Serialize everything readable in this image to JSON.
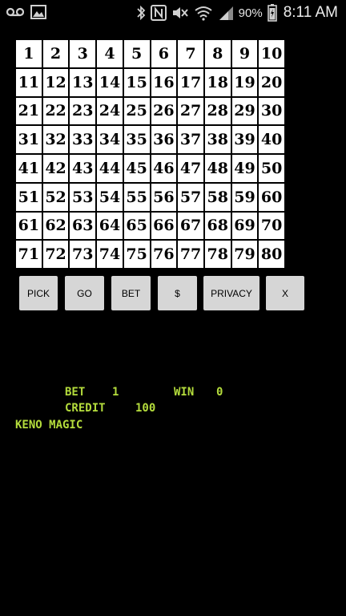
{
  "status_bar": {
    "left_icons": [
      "voicemail-icon",
      "image-icon"
    ],
    "right_icons": [
      "bluetooth-icon",
      "nfc-icon",
      "mute-icon",
      "wifi-icon",
      "signal-icon",
      "battery-icon"
    ],
    "battery_percent": "90%",
    "time": "8:11 AM"
  },
  "board": {
    "numbers": [
      "1",
      "2",
      "3",
      "4",
      "5",
      "6",
      "7",
      "8",
      "9",
      "10",
      "11",
      "12",
      "13",
      "14",
      "15",
      "16",
      "17",
      "18",
      "19",
      "20",
      "21",
      "22",
      "23",
      "24",
      "25",
      "26",
      "27",
      "28",
      "29",
      "30",
      "31",
      "32",
      "33",
      "34",
      "35",
      "36",
      "37",
      "38",
      "39",
      "40",
      "41",
      "42",
      "43",
      "44",
      "45",
      "46",
      "47",
      "48",
      "49",
      "50",
      "51",
      "52",
      "53",
      "54",
      "55",
      "56",
      "57",
      "58",
      "59",
      "60",
      "61",
      "62",
      "63",
      "64",
      "65",
      "66",
      "67",
      "68",
      "69",
      "70",
      "71",
      "72",
      "73",
      "74",
      "75",
      "76",
      "77",
      "78",
      "79",
      "80"
    ]
  },
  "controls": {
    "pick": "PICK",
    "go": "GO",
    "bet": "BET",
    "dollar": "$",
    "privacy": "PRIVACY",
    "exit": "X"
  },
  "info": {
    "bet_label": "BET",
    "bet_value": "1",
    "win_label": "WIN",
    "win_value": "0",
    "credit_label": "CREDIT",
    "credit_value": "100",
    "game_title": "KENO MAGIC"
  },
  "colors": {
    "background": "#000000",
    "cell_bg": "#ffffff",
    "cell_text": "#000000",
    "button_bg": "#d6d6d6",
    "info_text": "#b4dc3c"
  }
}
